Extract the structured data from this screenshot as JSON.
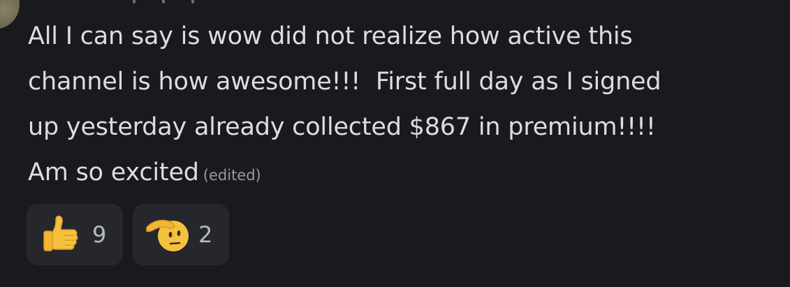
{
  "message": {
    "lines": [
      "All I can say is wow did not realize how active this",
      "channel is how awesome!!!  First full day as I signed",
      "up yesterday already collected $867 in premium!!!!",
      "Am so excited"
    ],
    "edited_label": "(edited)"
  },
  "reactions": [
    {
      "icon": "thumbs-up-icon",
      "count": "9"
    },
    {
      "icon": "saluting-face-icon",
      "count": "2"
    }
  ],
  "colors": {
    "background": "#1a1a1e",
    "text": "#dbdee1",
    "muted": "#949ba4",
    "reaction_bg": "#26272c"
  }
}
